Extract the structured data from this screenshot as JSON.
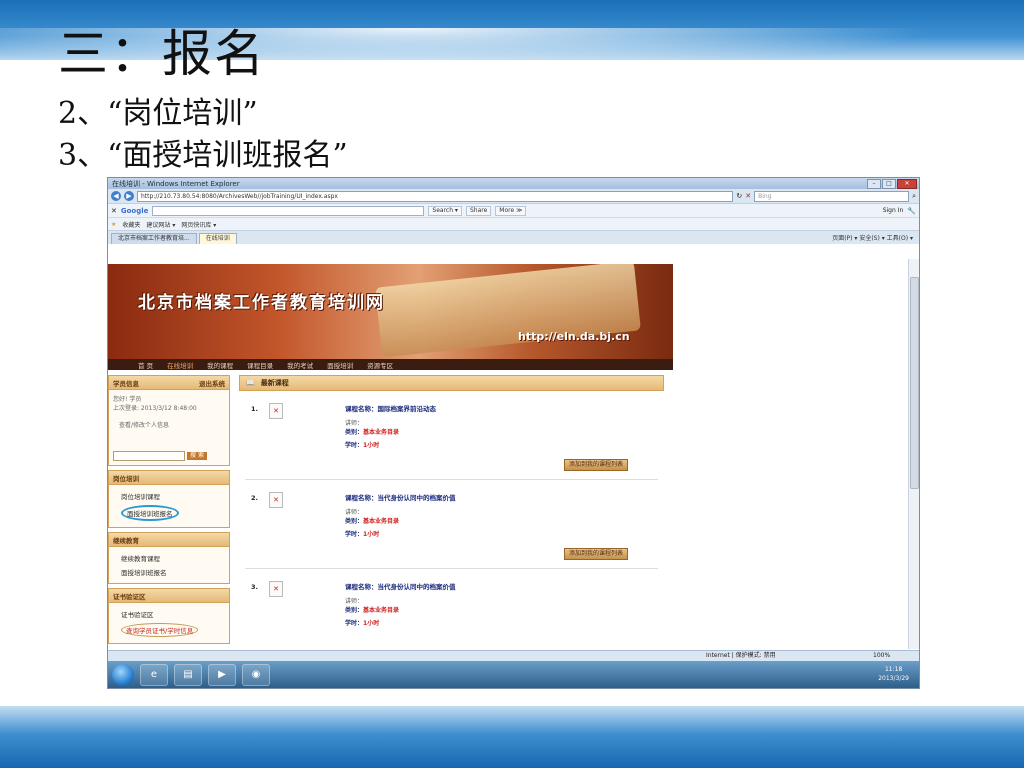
{
  "slide": {
    "title": "三：报名",
    "lines": [
      "2、“岗位培训”",
      "3、“面授培训班报名”"
    ]
  },
  "browser": {
    "window_title": "在线培训 - Windows Internet Explorer",
    "address": "http://210.73.80.54:8080/ArchivesWeb//jobTraining/UI_index.aspx",
    "search_placeholder": "Bing",
    "google_label": "Google",
    "google_search_btn": "Search ▾",
    "google_share_btn": "Share",
    "google_more_btn": "More ≫",
    "sign_in": "Sign In",
    "favorites_label": "收藏夹",
    "fav_items": [
      "建议网站 ▾",
      "网页快讯库 ▾"
    ],
    "tabs": [
      "北京市档案工作者教育培...",
      "在线培训"
    ],
    "command_bar": "页面(P) ▾  安全(S) ▾  工具(O) ▾",
    "status_zone": "Internet | 保护模式: 禁用",
    "zoom": "100%"
  },
  "site": {
    "banner_title": "北京市档案工作者教育培训网",
    "banner_url": "http://eln.da.bj.cn",
    "nav": [
      "首 页",
      "在线培训",
      "我的课程",
      "课程目录",
      "我的考试",
      "面授培训",
      "资源专区"
    ],
    "nav_active_index": 1,
    "sidebar": {
      "member_header": "学员信息",
      "member_link": "退出系统",
      "member_lines": [
        "您好! 学员",
        "上次登录: 2013/3/12 8:48:00",
        "查看/修改个人信息"
      ],
      "search_btn": "搜 索",
      "sections": [
        {
          "title": "岗位培训",
          "links": [
            "岗位培训课程",
            "面授培训班报名"
          ],
          "circled": 1
        },
        {
          "title": "继续教育",
          "links": [
            "继续教育课程",
            "面授培训班报名"
          ],
          "circled": -1
        },
        {
          "title": "证书验证区",
          "links": [
            "证书验证区",
            "查询学员证书/学时信息"
          ],
          "circled": 1
        }
      ]
    },
    "main_header": "最新课程",
    "courses": [
      {
        "num": "1.",
        "name_label": "课程名称：",
        "name": "国际档案界前沿动态",
        "teacher_label": "讲师：",
        "category_label": "类别：",
        "category": "基本业务目录",
        "hours_label": "学时：",
        "hours": "1小时",
        "add_btn": "添加到我的课程列表"
      },
      {
        "num": "2.",
        "name_label": "课程名称：",
        "name": "当代身份认同中的档案价值",
        "teacher_label": "讲师：",
        "category_label": "类别：",
        "category": "基本业务目录",
        "hours_label": "学时：",
        "hours": "1小时",
        "add_btn": "添加到我的课程列表"
      },
      {
        "num": "3.",
        "name_label": "课程名称：",
        "name": "当代身份认同中的档案价值",
        "teacher_label": "讲师：",
        "category_label": "类别：",
        "category": "基本业务目录",
        "hours_label": "学时：",
        "hours": "1小时",
        "add_btn": "添加到我的课程列表"
      }
    ]
  },
  "taskbar": {
    "time": "11:18",
    "date": "2013/3/29"
  }
}
